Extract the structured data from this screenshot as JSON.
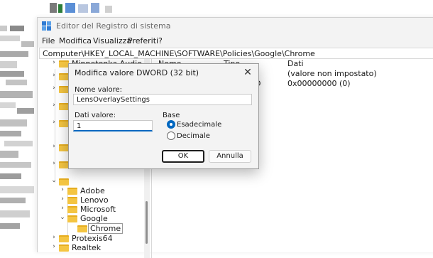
{
  "window": {
    "title": "Editor del Registro di sistema",
    "menu": [
      "File",
      "Modifica",
      "Visualizza",
      "Preferiti",
      "?"
    ],
    "address": "Computer\\HKEY_LOCAL_MACHINE\\SOFTWARE\\Policies\\Google\\Chrome"
  },
  "tree": {
    "items": [
      {
        "label": "Minnetonka Audio Softwar",
        "chevron": "›",
        "level": 0
      },
      {
        "label": "Adobe",
        "chevron": "›",
        "level": 1
      },
      {
        "label": "Lenovo",
        "chevron": "›",
        "level": 1
      },
      {
        "label": "Microsoft",
        "chevron": "›",
        "level": 1
      },
      {
        "label": "Google",
        "chevron": "⌄",
        "level": 1
      },
      {
        "label": "Chrome",
        "chevron": "",
        "level": 2,
        "selected": true
      },
      {
        "label": "Protexis64",
        "chevron": "›",
        "level": 0
      },
      {
        "label": "Realtek",
        "chevron": "›",
        "level": 0
      }
    ]
  },
  "list": {
    "columns": [
      "Nome",
      "Tipo",
      "Dati"
    ],
    "partial_name": "D",
    "rows": [
      {
        "data": "(valore non impostato)"
      },
      {
        "data": "0x00000000 (0)"
      }
    ]
  },
  "dialog": {
    "title": "Modifica valore DWORD (32 bit)",
    "close": "✕",
    "name_label": "Nome valore:",
    "name_value": "LensOverlaySettings",
    "data_label": "Dati valore:",
    "data_value": "1",
    "base_label": "Base",
    "base_options": [
      {
        "label": "Esadecimale",
        "selected": true
      },
      {
        "label": "Decimale",
        "selected": false
      }
    ],
    "ok": "OK",
    "cancel": "Annulla"
  },
  "colors": {
    "accent": "#0067c0",
    "folder": "#f4c542"
  },
  "icons": {
    "app": "registry-editor-icon",
    "folder": "folder-icon",
    "close": "close-icon"
  }
}
